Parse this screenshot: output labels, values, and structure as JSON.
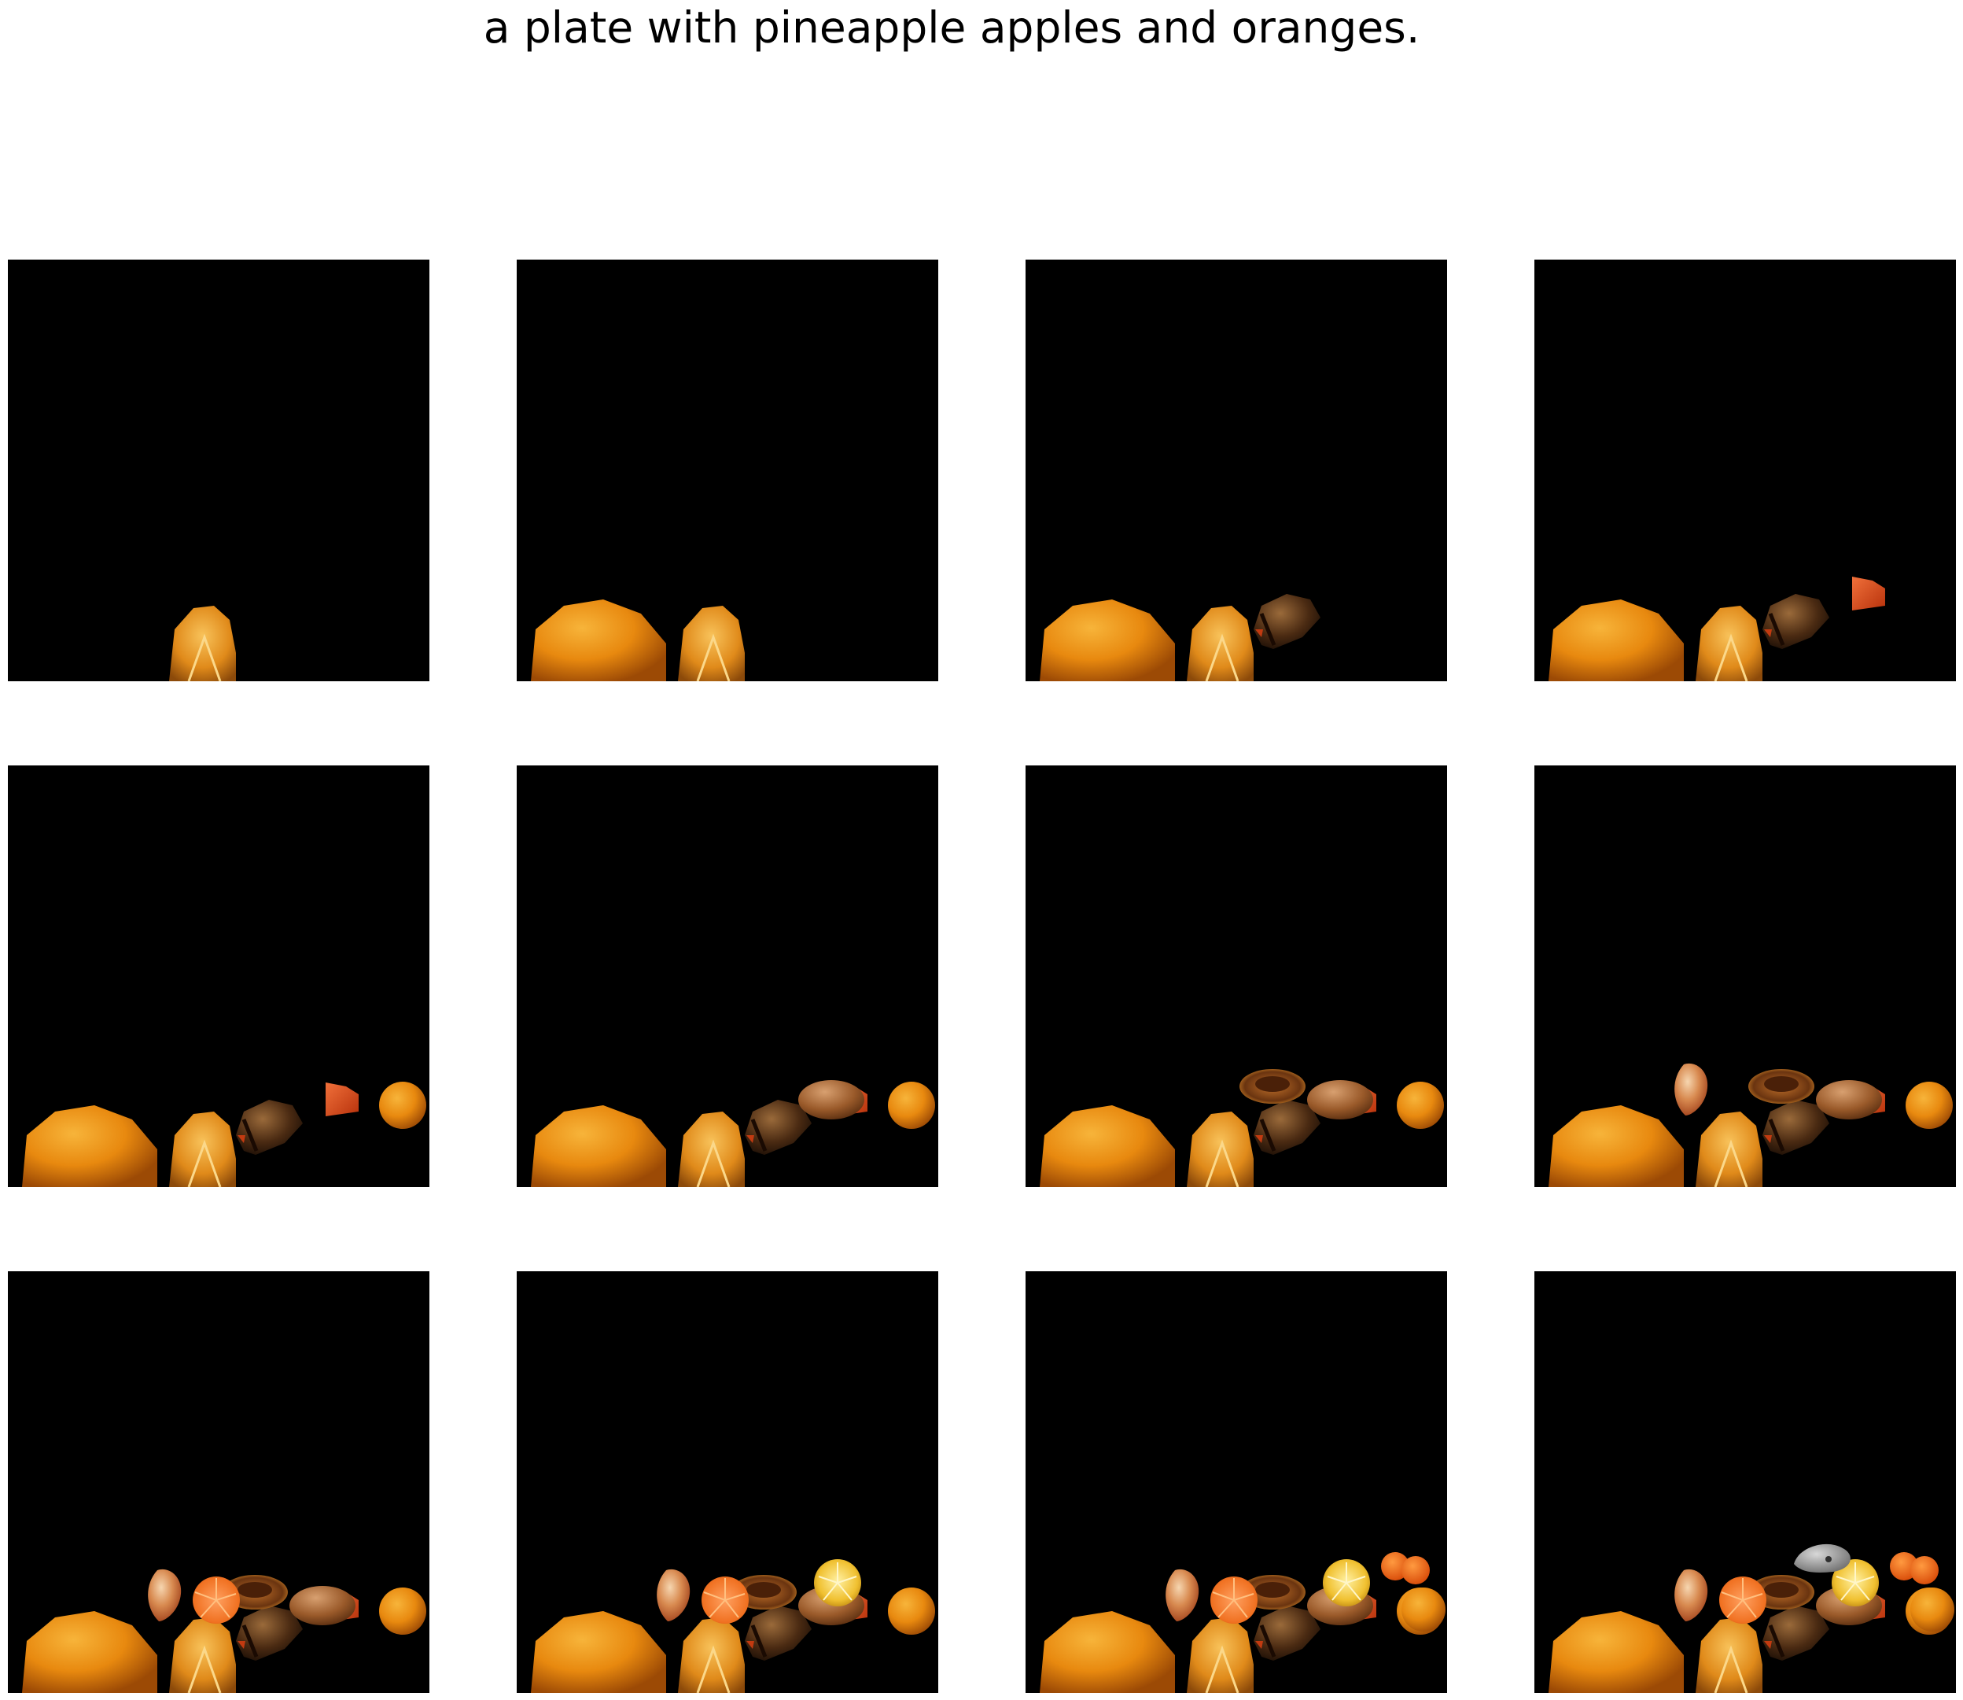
{
  "figure": {
    "title": "a plate with pineapple apples and oranges."
  },
  "panels": [
    {
      "step": 1,
      "objects": [
        "orange-slice"
      ]
    },
    {
      "step": 2,
      "objects": [
        "orange",
        "orange-slice"
      ]
    },
    {
      "step": 3,
      "objects": [
        "orange",
        "orange-slice",
        "dark-fruit"
      ]
    },
    {
      "step": 4,
      "objects": [
        "orange",
        "orange-slice",
        "dark-fruit",
        "red-wedge"
      ]
    },
    {
      "step": 5,
      "objects": [
        "orange",
        "orange-slice",
        "dark-fruit",
        "red-wedge",
        "small-orange"
      ]
    },
    {
      "step": 6,
      "objects": [
        "orange",
        "orange-slice",
        "dark-fruit",
        "red-wedge",
        "small-orange",
        "brown-fruit"
      ]
    },
    {
      "step": 7,
      "objects": [
        "orange",
        "orange-slice",
        "dark-fruit",
        "red-wedge",
        "small-orange",
        "brown-fruit",
        "dried-orange-slice"
      ]
    },
    {
      "step": 8,
      "objects": [
        "orange",
        "orange-slice",
        "dark-fruit",
        "red-wedge",
        "small-orange",
        "brown-fruit",
        "dried-orange-slice",
        "peach"
      ]
    },
    {
      "step": 9,
      "objects": [
        "orange",
        "orange-slice",
        "dark-fruit",
        "red-wedge",
        "small-orange",
        "brown-fruit",
        "dried-orange-slice",
        "peach",
        "blood-orange-slice"
      ]
    },
    {
      "step": 10,
      "objects": [
        "orange",
        "orange-slice",
        "dark-fruit",
        "red-wedge",
        "small-orange",
        "brown-fruit",
        "dried-orange-slice",
        "peach",
        "blood-orange-slice",
        "lemon-half"
      ]
    },
    {
      "step": 11,
      "objects": [
        "orange",
        "orange-slice",
        "dark-fruit",
        "red-wedge",
        "small-orange",
        "brown-fruit",
        "dried-orange-slice",
        "peach",
        "blood-orange-slice",
        "lemon-half",
        "tangerines"
      ]
    },
    {
      "step": 12,
      "objects": [
        "orange",
        "orange-slice",
        "dark-fruit",
        "red-wedge",
        "small-orange",
        "brown-fruit",
        "dried-orange-slice",
        "peach",
        "blood-orange-slice",
        "lemon-half",
        "tangerines",
        "gray-stone"
      ]
    }
  ]
}
